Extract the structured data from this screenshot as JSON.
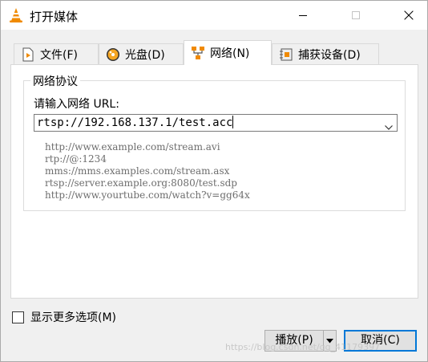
{
  "window": {
    "title": "打开媒体"
  },
  "tabs": [
    {
      "label": "文件(F)",
      "icon": "file-play-icon"
    },
    {
      "label": "光盘(D)",
      "icon": "disc-icon"
    },
    {
      "label": "网络(N)",
      "icon": "network-icon",
      "active": true
    },
    {
      "label": "捕获设备(D)",
      "icon": "capture-device-icon"
    }
  ],
  "network": {
    "group_title": "网络协议",
    "url_label": "请输入网络 URL:",
    "url_value": "rtsp://192.168.137.1/test.acc",
    "examples": [
      "http://www.example.com/stream.avi",
      "rtp://@:1234",
      "mms://mms.examples.com/stream.asx",
      "rtsp://server.example.org:8080/test.sdp",
      "http://www.yourtube.com/watch?v=gg64x"
    ]
  },
  "options": {
    "more_options_label": "显示更多选项(M)",
    "checked": false
  },
  "buttons": {
    "play": "播放(P)",
    "cancel": "取消(C)"
  },
  "watermark": "https://blog.csdn.net/qq_41179397",
  "colors": {
    "accent": "#0078d7",
    "vlc_orange": "#f08a00"
  }
}
